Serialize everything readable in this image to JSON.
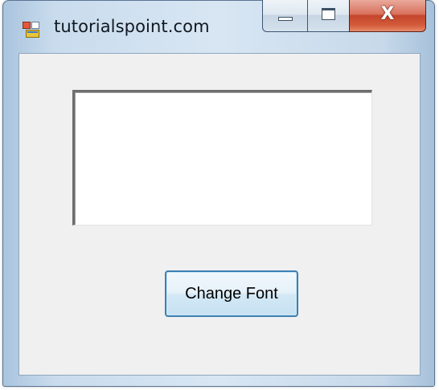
{
  "window": {
    "title": "tutorialspoint.com"
  },
  "titlebar": {
    "icons": {
      "app": "app-icon",
      "minimize": "minimize-icon",
      "maximize": "maximize-icon",
      "close": "close-icon"
    },
    "close_glyph": "X"
  },
  "form": {
    "textbox_value": "",
    "button_label": "Change Font"
  },
  "colors": {
    "close_button": "#c4452c",
    "button_border": "#3c7fb1",
    "client_background": "#f0f0f0"
  }
}
